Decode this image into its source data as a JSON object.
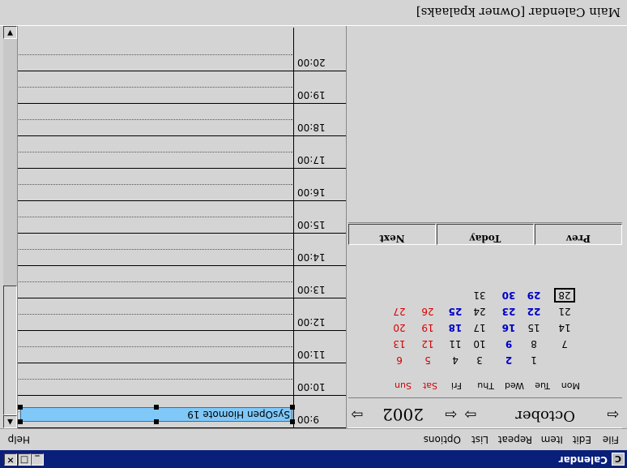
{
  "window": {
    "title": "Calendar",
    "icon": "calendar-app-icon",
    "buttons": [
      "_",
      "□",
      "×"
    ]
  },
  "menu": {
    "items": [
      "File",
      "Edit",
      "Item",
      "Repeat",
      "List",
      "Options"
    ],
    "help": "Help"
  },
  "month_nav": {
    "prev_month_arrow": "⇦",
    "month": "October",
    "next_month_arrow": "⇨",
    "prev_year_arrow": "⇦",
    "year": "2002",
    "next_year_arrow": "⇨"
  },
  "weekdays": [
    "Mon",
    "Tue",
    "Wed",
    "Thu",
    "Fri",
    "Sat",
    "Sun"
  ],
  "weeks": [
    [
      "",
      "1",
      "2",
      "3",
      "4",
      "5",
      "6"
    ],
    [
      "7",
      "8",
      "9",
      "10",
      "11",
      "12",
      "13"
    ],
    [
      "14",
      "15",
      "16",
      "17",
      "18",
      "19",
      "20"
    ],
    [
      "21",
      "22",
      "23",
      "24",
      "25",
      "26",
      "27"
    ],
    [
      "28",
      "29",
      "30",
      "31",
      "",
      "",
      ""
    ]
  ],
  "bold_blue_days": [
    "2",
    "9",
    "16",
    "18",
    "22",
    "23",
    "25",
    "29",
    "30"
  ],
  "today": "28",
  "nav_buttons": {
    "prev": "Prev",
    "today": "Today",
    "next": "Next"
  },
  "day_view": {
    "hours": [
      "9:00",
      "10:00",
      "11:00",
      "12:00",
      "13:00",
      "14:00",
      "15:00",
      "16:00",
      "17:00",
      "18:00",
      "19:00",
      "20:00"
    ],
    "appointment": {
      "time": "9:00",
      "text": "SysOpen Hiomote 19"
    }
  },
  "status": {
    "text": "Main Calendar [Owner kpalaaks]"
  },
  "colors": {
    "titlebar": "#0a1f7a",
    "weekend": "#d60000",
    "highlight_day": "#0000c8",
    "appointment": "#80c8f8"
  }
}
